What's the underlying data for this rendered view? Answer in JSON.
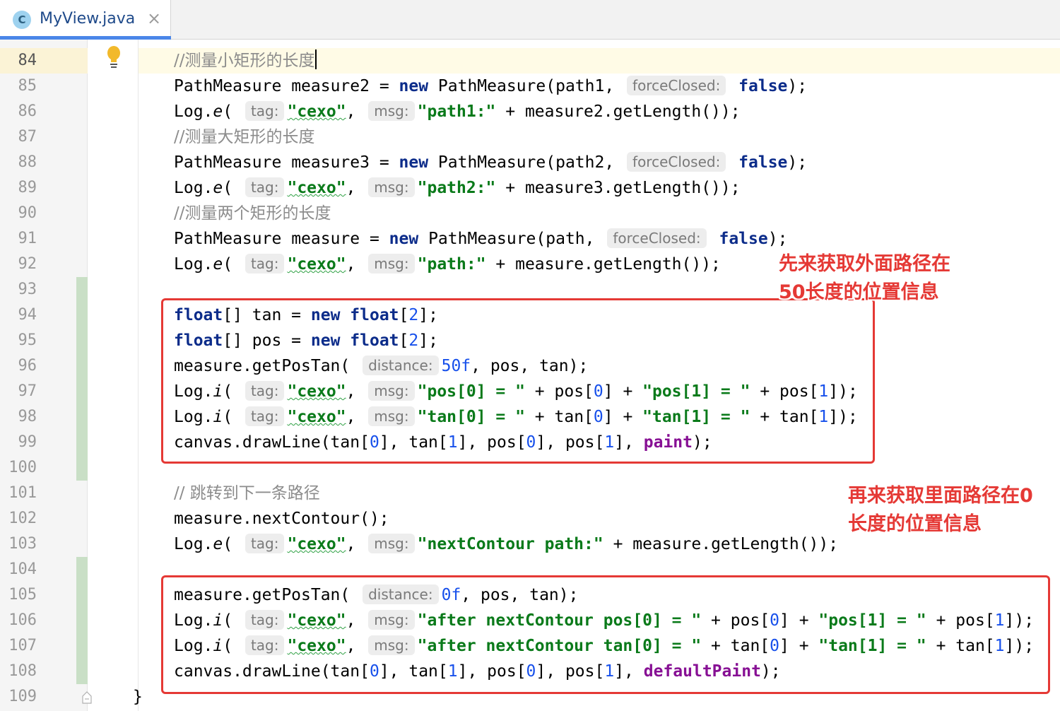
{
  "tab": {
    "icon_letter": "C",
    "title": "MyView.java",
    "close_glyph": "×"
  },
  "lines": [
    {
      "n": "84"
    },
    {
      "n": "85"
    },
    {
      "n": "86"
    },
    {
      "n": "87"
    },
    {
      "n": "88"
    },
    {
      "n": "89"
    },
    {
      "n": "90"
    },
    {
      "n": "91"
    },
    {
      "n": "92"
    },
    {
      "n": "93"
    },
    {
      "n": "94"
    },
    {
      "n": "95"
    },
    {
      "n": "96"
    },
    {
      "n": "97"
    },
    {
      "n": "98"
    },
    {
      "n": "99"
    },
    {
      "n": "100"
    },
    {
      "n": "101"
    },
    {
      "n": "102"
    },
    {
      "n": "103"
    },
    {
      "n": "104"
    },
    {
      "n": "105"
    },
    {
      "n": "106"
    },
    {
      "n": "107"
    },
    {
      "n": "108"
    },
    {
      "n": "109"
    }
  ],
  "tokens": {
    "comment_small": "//测量小矩形的长度",
    "comment_big": "//测量大矩形的长度",
    "comment_both": "//测量两个矩形的长度",
    "comment_next": "// 跳转到下一条路径",
    "pathmeasure": "PathMeasure",
    "measure2": "measure2",
    "measure3": "measure3",
    "measure": "measure",
    "new": "new",
    "float": "float",
    "false": "false",
    "log": "Log.",
    "e": "e",
    "i": "i",
    "hint_forceClosed": "forceClosed:",
    "hint_tag": "tag:",
    "hint_msg": "msg:",
    "hint_distance": "distance:",
    "cexo": "\"cexo\"",
    "path1_str": "\"path1:\"",
    "path2_str": "\"path2:\"",
    "path_str": "\"path:\"",
    "pos0_str": "\"pos[0] = \"",
    "pos1_str": "\"pos[1] = \"",
    "tan0_str": "\"tan[0] = \"",
    "tan1_str": "\"tan[1] = \"",
    "next_path_str": "\"nextContour path:\"",
    "after_pos0_str": "\"after nextContour pos[0] = \"",
    "after_tan0_str": "\"after nextContour tan[0] = \"",
    "num_2": "2",
    "num_0": "0",
    "num_1": "1",
    "num_50f": "50f",
    "num_0f": "0f",
    "paint": "paint",
    "defaultPaint": "defaultPaint",
    "close_brace": "}"
  },
  "annotations": {
    "first_line1": "先来获取外面路径在",
    "first_line2": "50长度的位置信息",
    "second_line1": "再来获取里面路径在0",
    "second_line2": "长度的位置信息"
  },
  "colors": {
    "keyword": "#0c2c8a",
    "string": "#0a7a1a",
    "number": "#1750eb",
    "comment": "#8c8c8c",
    "field": "#871094",
    "annotation_red": "#e53935",
    "tab_accent": "#4a86e8"
  }
}
